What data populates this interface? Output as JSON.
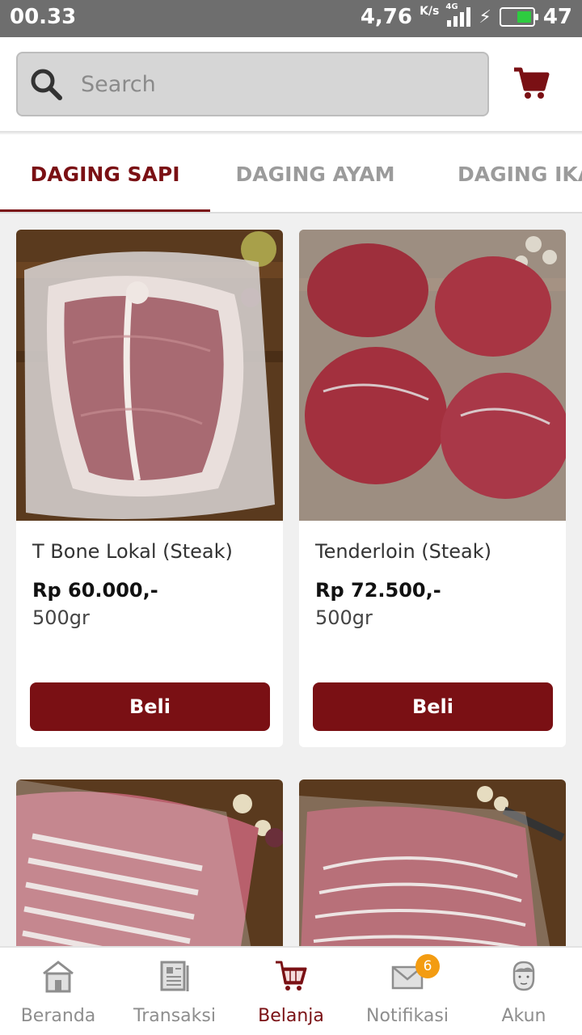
{
  "status_bar": {
    "time": "00.33",
    "net_speed": "4,76",
    "net_unit": "K/s",
    "network": "4G",
    "battery": "47",
    "battery_level": 0.47
  },
  "search": {
    "placeholder": "Search"
  },
  "tabs": [
    {
      "label": "DAGING SAPI",
      "active": true
    },
    {
      "label": "DAGING AYAM",
      "active": false
    },
    {
      "label": "DAGING IKAN",
      "active": false
    }
  ],
  "products": [
    {
      "name": "T Bone Lokal (Steak)",
      "price": "Rp 60.000,-",
      "weight": "500gr",
      "button": "Beli"
    },
    {
      "name": "Tenderloin (Steak)",
      "price": "Rp 72.500,-",
      "weight": "500gr",
      "button": "Beli"
    }
  ],
  "bottom_nav": [
    {
      "label": "Beranda",
      "icon": "home-icon",
      "active": false
    },
    {
      "label": "Transaksi",
      "icon": "receipt-icon",
      "active": false
    },
    {
      "label": "Belanja",
      "icon": "cart-icon",
      "active": true
    },
    {
      "label": "Notifikasi",
      "icon": "mail-icon",
      "active": false,
      "badge": "6"
    },
    {
      "label": "Akun",
      "icon": "user-icon",
      "active": false
    }
  ],
  "colors": {
    "brand": "#7a1014",
    "badge": "#f39c12",
    "status_bar": "#6e6e6e"
  }
}
